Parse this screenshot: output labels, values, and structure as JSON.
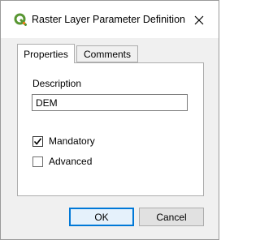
{
  "window": {
    "title": "Raster Layer Parameter Definition",
    "icon": "qgis-icon",
    "close_icon": "close-icon"
  },
  "tabs": [
    {
      "label": "Properties",
      "active": true
    },
    {
      "label": "Comments",
      "active": false
    }
  ],
  "properties": {
    "description_label": "Description",
    "description_value": "DEM",
    "mandatory_label": "Mandatory",
    "mandatory_checked": true,
    "advanced_label": "Advanced",
    "advanced_checked": false
  },
  "buttons": {
    "ok_label": "OK",
    "cancel_label": "Cancel"
  },
  "colors": {
    "accent": "#0078d7",
    "qgis_green": "#589632",
    "qgis_yellow": "#ee7913"
  }
}
